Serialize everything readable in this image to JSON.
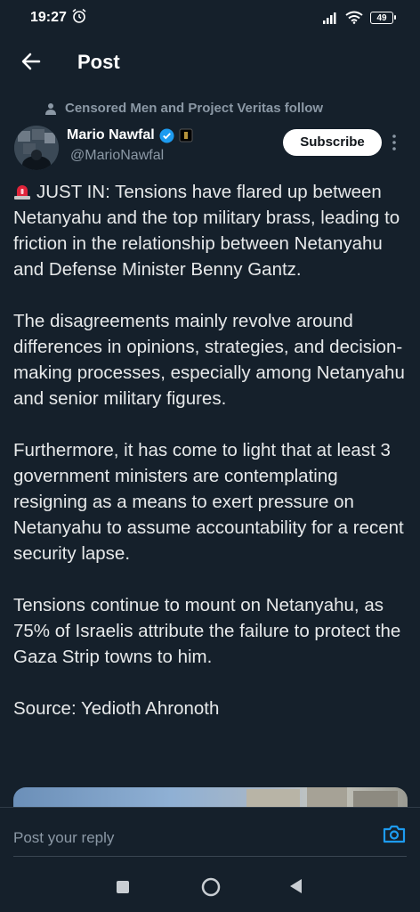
{
  "status_bar": {
    "time": "19:27",
    "battery": "49"
  },
  "header": {
    "title": "Post"
  },
  "social_context": "Censored Men and Project Veritas follow",
  "author": {
    "name": "Mario Nawfal",
    "handle": "@MarioNawfal",
    "subscribe_label": "Subscribe"
  },
  "post": {
    "paragraphs": [
      "JUST IN: Tensions have flared up between Netanyahu and the top military brass, leading to friction in the relationship between Netanyahu and Defense Minister Benny Gantz.",
      "The disagreements mainly revolve around differences in opinions, strategies, and decision-making processes, especially among Netanyahu and senior military figures.",
      "Furthermore, it has come to light that at least 3 government ministers are contemplating resigning as a means to exert pressure on Netanyahu to assume accountability for a recent security lapse.",
      "Tensions continue to mount on Netanyahu, as 75% of Israelis attribute the failure to protect the Gaza Strip towns to him.",
      "Source: Yedioth Ahronoth"
    ]
  },
  "reply": {
    "placeholder": "Post your reply"
  },
  "icons": {
    "back": "arrow-left-icon",
    "verified": "verified-badge-icon",
    "siren": "rotating-light-emoji",
    "camera": "camera-icon"
  },
  "colors": {
    "background": "#15202b",
    "accent": "#1d9bf0",
    "secondary_text": "#8b98a5"
  }
}
